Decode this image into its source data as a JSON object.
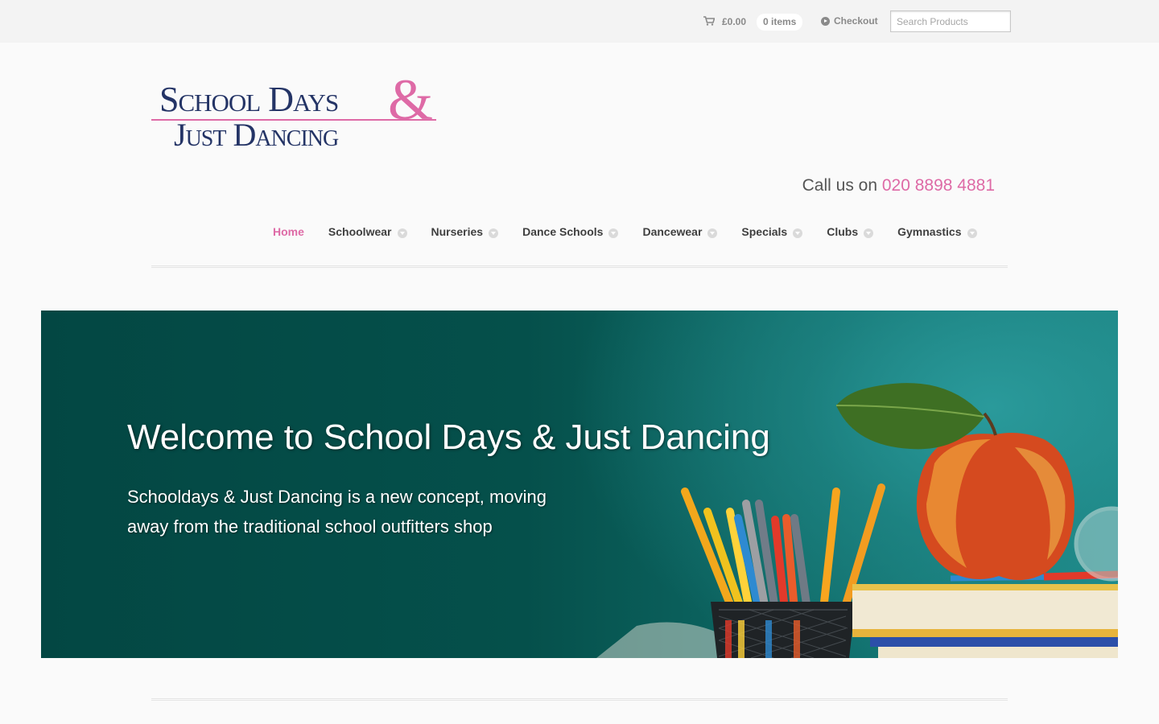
{
  "topbar": {
    "cart_total": "£0.00",
    "cart_items": "0 items",
    "checkout_label": "Checkout",
    "search_placeholder": "Search Products",
    "icons": [
      "cart-icon",
      "checkout-arrow-icon"
    ]
  },
  "logo": {
    "line1": "School Days",
    "ampersand": "&",
    "line2": "Just Dancing"
  },
  "header": {
    "call_prefix": "Call us on",
    "phone": "020 8898 4881"
  },
  "nav": {
    "items": [
      {
        "label": "Home",
        "active": true,
        "dropdown": false
      },
      {
        "label": "Schoolwear",
        "active": false,
        "dropdown": true
      },
      {
        "label": "Nurseries",
        "active": false,
        "dropdown": true
      },
      {
        "label": "Dance Schools",
        "active": false,
        "dropdown": true
      },
      {
        "label": "Dancewear",
        "active": false,
        "dropdown": true
      },
      {
        "label": "Specials",
        "active": false,
        "dropdown": true
      },
      {
        "label": "Clubs",
        "active": false,
        "dropdown": true
      },
      {
        "label": "Gymnastics",
        "active": false,
        "dropdown": true
      }
    ]
  },
  "hero": {
    "title": "Welcome to School Days & Just Dancing",
    "text": "Schooldays & Just Dancing is a new concept, moving away from the traditional school outfitters shop"
  },
  "colors": {
    "brand_pink": "#de6aa6",
    "brand_navy": "#243466",
    "hero_teal": "#05504b"
  }
}
